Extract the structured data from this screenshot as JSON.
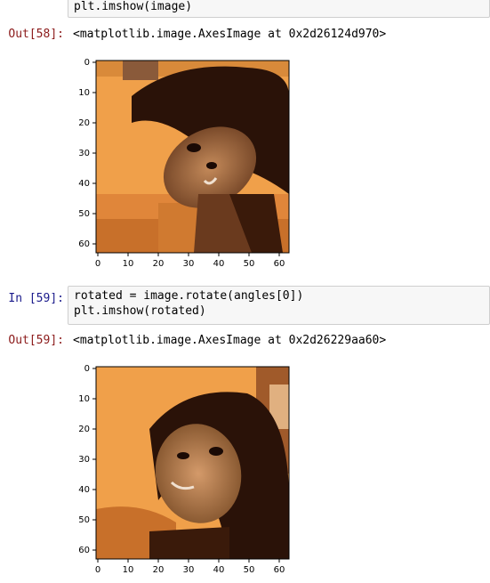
{
  "cells": {
    "top_code": "plt.imshow(image)",
    "out58": {
      "prompt": "Out[58]:",
      "text": "<matplotlib.image.AxesImage at 0x2d26124d970>"
    },
    "in59": {
      "prompt": "In [59]:",
      "lines": [
        "rotated = image.rotate(angles[0])",
        "plt.imshow(rotated)"
      ]
    },
    "out59": {
      "prompt": "Out[59]:",
      "text": "<matplotlib.image.AxesImage at 0x2d26229aa60>"
    }
  },
  "plots": {
    "y_ticks": [
      "0",
      "10",
      "20",
      "30",
      "40",
      "50",
      "60"
    ],
    "x_ticks": [
      "0",
      "10",
      "20",
      "30",
      "40",
      "50",
      "60"
    ]
  }
}
